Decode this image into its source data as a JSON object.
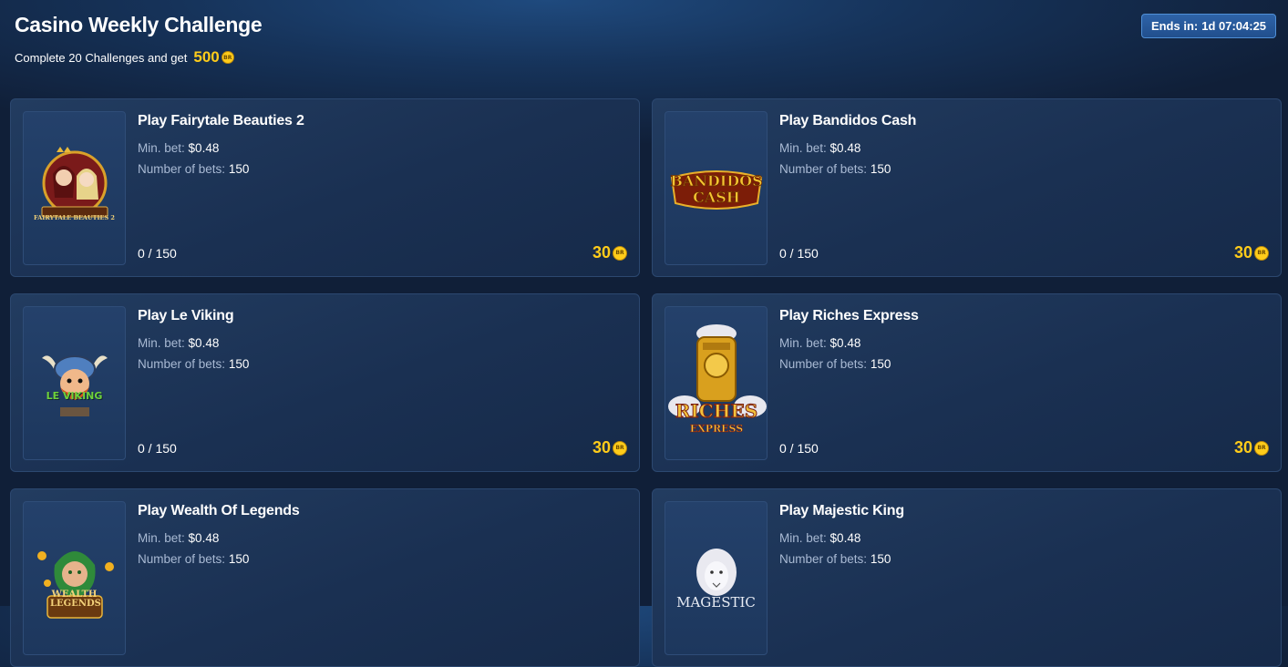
{
  "header": {
    "title": "Casino Weekly Challenge",
    "subtitle_prefix": "Complete 20 Challenges and get",
    "subtitle_amount": "500",
    "coin_label": "BR",
    "timer_label": "Ends in:",
    "timer_value": "1d 07:04:25"
  },
  "labels": {
    "min_bet": "Min. bet:",
    "num_bets": "Number of bets:"
  },
  "challenges": [
    {
      "title": "Play Fairytale Beauties 2",
      "min_bet": "$0.48",
      "num_bets": "150",
      "progress": "0 / 150",
      "reward": "30",
      "art": "FAIRYTALE BEAUTIES 2"
    },
    {
      "title": "Play Bandidos Cash",
      "min_bet": "$0.48",
      "num_bets": "150",
      "progress": "0 / 150",
      "reward": "30",
      "art": "BANDIDOS CASH"
    },
    {
      "title": "Play Le Viking",
      "min_bet": "$0.48",
      "num_bets": "150",
      "progress": "0 / 150",
      "reward": "30",
      "art": "LE VIKING"
    },
    {
      "title": "Play Riches Express",
      "min_bet": "$0.48",
      "num_bets": "150",
      "progress": "0 / 150",
      "reward": "30",
      "art": "RICHES EXPRESS"
    },
    {
      "title": "Play Wealth Of Legends",
      "min_bet": "$0.48",
      "num_bets": "150",
      "progress": "",
      "reward": "",
      "art": "WEALTH LEGENDS"
    },
    {
      "title": "Play Majestic King",
      "min_bet": "$0.48",
      "num_bets": "150",
      "progress": "",
      "reward": "",
      "art": "MAGESTIC"
    }
  ],
  "colors": {
    "accent_gold": "#ffcc1a",
    "timer_blue": "#2e63a8",
    "card_bg": "#1a3052"
  }
}
